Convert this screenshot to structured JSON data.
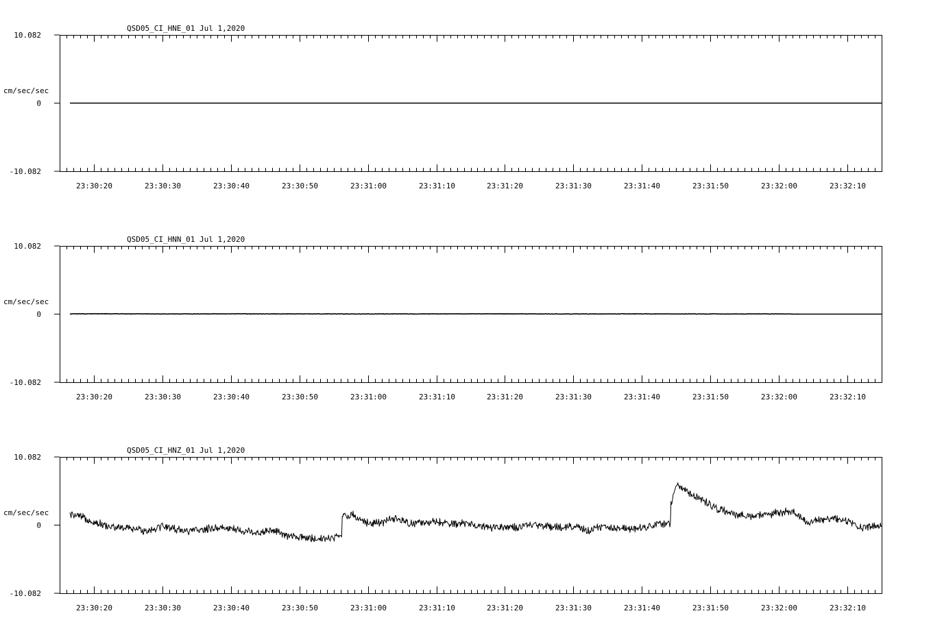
{
  "chart_data": [
    {
      "type": "line",
      "title": "QSD05_CI_HNE_01  Jul 1,2020",
      "ylabel": "cm/sec/sec",
      "ylim": [
        -10.082,
        10.082
      ],
      "ytick_labels": [
        "10.082",
        "0",
        "-10.082"
      ],
      "xlim": [
        "23:30:15",
        "23:32:15"
      ],
      "xtick_labels": [
        "23:30:20",
        "23:30:30",
        "23:30:40",
        "23:30:50",
        "23:31:00",
        "23:31:10",
        "23:31:20",
        "23:31:30",
        "23:31:40",
        "23:31:50",
        "23:32:00",
        "23:32:10"
      ],
      "series": [
        {
          "color": "#000000",
          "x": [
            "23:30:16.5",
            "23:32:15"
          ],
          "values": [
            0,
            0
          ]
        }
      ]
    },
    {
      "type": "line",
      "title": "QSD05_CI_HNN_01  Jul 1,2020",
      "ylabel": "cm/sec/sec",
      "ylim": [
        -10.082,
        10.082
      ],
      "ytick_labels": [
        "10.082",
        "0",
        "-10.082"
      ],
      "xlim": [
        "23:30:15",
        "23:32:15"
      ],
      "xtick_labels": [
        "23:30:20",
        "23:30:30",
        "23:30:40",
        "23:30:50",
        "23:31:00",
        "23:31:10",
        "23:31:20",
        "23:31:30",
        "23:31:40",
        "23:31:50",
        "23:32:00",
        "23:32:10"
      ],
      "series": [
        {
          "color": "#000000",
          "x": [
            "23:30:16.5",
            "23:30:20",
            "23:30:30",
            "23:30:40",
            "23:30:50",
            "23:31:00",
            "23:31:10",
            "23:31:20",
            "23:31:30",
            "23:31:40",
            "23:31:50",
            "23:32:00",
            "23:32:03",
            "23:32:15"
          ],
          "values": [
            0.03,
            0.05,
            0.02,
            0.04,
            0.03,
            0.02,
            0.03,
            0.04,
            0.02,
            0.03,
            0.02,
            0.03,
            0,
            0
          ]
        }
      ]
    },
    {
      "type": "line",
      "title": "QSD05_CI_HNZ_01  Jul 1,2020",
      "ylabel": "cm/sec/sec",
      "ylim": [
        -10.082,
        10.082
      ],
      "ytick_labels": [
        "10.082",
        "0",
        "-10.082"
      ],
      "xlim": [
        "23:30:15",
        "23:32:15"
      ],
      "xtick_labels": [
        "23:30:20",
        "23:30:30",
        "23:30:40",
        "23:30:50",
        "23:31:00",
        "23:31:10",
        "23:31:20",
        "23:31:30",
        "23:31:40",
        "23:31:50",
        "23:32:00",
        "23:32:10"
      ],
      "series": [
        {
          "color": "#000000",
          "x": [
            "23:30:16.5",
            "23:30:18",
            "23:30:20",
            "23:30:22",
            "23:30:24",
            "23:30:26",
            "23:30:28",
            "23:30:30",
            "23:30:32",
            "23:30:34",
            "23:30:36",
            "23:30:38",
            "23:30:40",
            "23:30:42",
            "23:30:44",
            "23:30:46",
            "23:30:48",
            "23:30:50",
            "23:30:52",
            "23:30:54",
            "23:30:56",
            "23:30:56.5",
            "23:30:58",
            "23:31:00",
            "23:31:02",
            "23:31:04",
            "23:31:06",
            "23:31:08",
            "23:31:10",
            "23:31:12",
            "23:31:14",
            "23:31:16",
            "23:31:18",
            "23:31:20",
            "23:31:22",
            "23:31:24",
            "23:31:26",
            "23:31:28",
            "23:31:30",
            "23:31:32",
            "23:31:34",
            "23:31:36",
            "23:31:38",
            "23:31:40",
            "23:31:42",
            "23:31:44",
            "23:31:44.4",
            "23:31:45",
            "23:31:47",
            "23:31:49",
            "23:31:51",
            "23:31:54",
            "23:31:58",
            "23:32:01",
            "23:32:02",
            "23:32:04",
            "23:32:07",
            "23:32:09",
            "23:32:12",
            "23:32:15"
          ],
          "values": [
            1.5,
            1.2,
            0.5,
            -0.2,
            -0.4,
            -0.6,
            -0.8,
            -0.1,
            -0.6,
            -0.9,
            -0.7,
            -0.3,
            -0.5,
            -0.9,
            -1.1,
            -0.7,
            -1.6,
            -1.8,
            -2.0,
            -1.9,
            -1.7,
            1.5,
            1.4,
            0.3,
            0.4,
            0.9,
            0.3,
            0.2,
            0.5,
            0.1,
            0.3,
            -0.1,
            -0.3,
            -0.2,
            -0.4,
            0.0,
            -0.1,
            -0.3,
            -0.2,
            -0.8,
            -0.3,
            -0.5,
            -0.4,
            -0.4,
            0.1,
            0.2,
            3.5,
            6.0,
            4.8,
            3.5,
            2.5,
            1.3,
            1.5,
            2.0,
            1.9,
            0.5,
            0.8,
            1.0,
            -0.3,
            -0.1
          ]
        }
      ]
    }
  ]
}
